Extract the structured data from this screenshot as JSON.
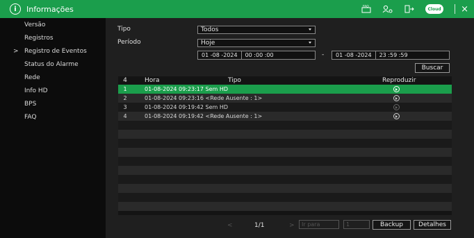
{
  "header": {
    "title": "Informações",
    "faq_label": "FAQ",
    "cloud_label": "Cloud",
    "close": "×"
  },
  "sidebar": {
    "items": [
      {
        "label": "Versão"
      },
      {
        "label": "Registros"
      },
      {
        "label": "Registro de Eventos",
        "active": true
      },
      {
        "label": "Status do Alarme"
      },
      {
        "label": "Rede"
      },
      {
        "label": "Info HD"
      },
      {
        "label": "BPS"
      },
      {
        "label": "FAQ"
      }
    ]
  },
  "filters": {
    "tipo_label": "Tipo",
    "tipo_value": "Todos",
    "periodo_label": "Período",
    "periodo_value": "Hoje",
    "start_date": "01 -08 -2024",
    "start_time": "00 :00 :00",
    "end_date": "01 -08 -2024",
    "end_time": "23 :59 :59",
    "dash": "-",
    "search_button": "Buscar"
  },
  "table": {
    "headers": {
      "count": "4",
      "hora": "Hora",
      "tipo": "Tipo",
      "reproduzir": "Reproduzir"
    },
    "rows": [
      {
        "idx": "1",
        "text": "01-08-2024 09:23:17  Sem HD"
      },
      {
        "idx": "2",
        "text": "01-08-2024 09:23:16  <Rede Ausente : 1>"
      },
      {
        "idx": "3",
        "text": "01-08-2024 09:19:42  Sem HD"
      },
      {
        "idx": "4",
        "text": "01-08-2024 09:19:42  <Rede Ausente : 1>"
      }
    ]
  },
  "pager": {
    "prev": "<",
    "page": "1/1",
    "next": ">",
    "goto_placeholder": "Ir para",
    "goto_value": "1",
    "backup_button": "Backup",
    "details_button": "Detalhes"
  },
  "colors": {
    "accent": "#1b9e4c"
  }
}
